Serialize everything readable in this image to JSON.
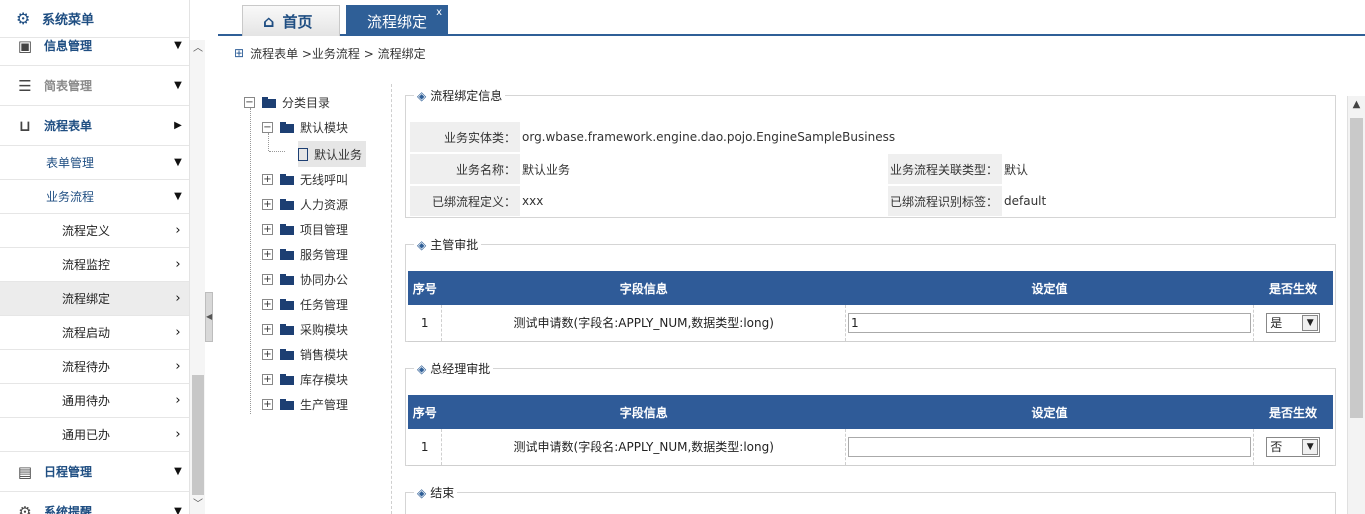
{
  "sidebar": {
    "title": "系统菜单",
    "items": [
      {
        "label": "信息管理",
        "level": 1,
        "icon": "calendar-icon",
        "arrow": "down"
      },
      {
        "label": "简表管理",
        "level": 1,
        "icon": "list-icon",
        "arrow": "down",
        "muted": true
      },
      {
        "label": "流程表单",
        "level": 1,
        "icon": "inbox-icon",
        "arrow": "right"
      },
      {
        "label": "表单管理",
        "level": 2,
        "arrow": "down"
      },
      {
        "label": "业务流程",
        "level": 2,
        "arrow": "down"
      },
      {
        "label": "流程定义",
        "level": 3,
        "arrow": "right"
      },
      {
        "label": "流程监控",
        "level": 3,
        "arrow": "right"
      },
      {
        "label": "流程绑定",
        "level": 3,
        "arrow": "right",
        "active": true
      },
      {
        "label": "流程启动",
        "level": 3,
        "arrow": "right"
      },
      {
        "label": "流程待办",
        "level": 3,
        "arrow": "right"
      },
      {
        "label": "通用待办",
        "level": 3,
        "arrow": "right"
      },
      {
        "label": "通用已办",
        "level": 3,
        "arrow": "right"
      },
      {
        "label": "日程管理",
        "level": 1,
        "icon": "calendar-icon",
        "arrow": "down"
      },
      {
        "label": "系统提醒",
        "level": 1,
        "icon": "gear-icon",
        "arrow": "down"
      }
    ]
  },
  "tabs": {
    "home": "首页",
    "current": "流程绑定",
    "close": "x"
  },
  "breadcrumb": "流程表单 >业务流程 > 流程绑定",
  "tree": {
    "root": "分类目录",
    "default_module": "默认模块",
    "default_business": "默认业务",
    "modules": [
      "无线呼叫",
      "人力资源",
      "项目管理",
      "服务管理",
      "协同办公",
      "任务管理",
      "采购模块",
      "销售模块",
      "库存模块",
      "生产管理"
    ]
  },
  "binding_info": {
    "legend": "流程绑定信息",
    "entity_label": "业务实体类：",
    "entity_value": "org.wbase.framework.engine.dao.pojo.EngineSampleBusiness",
    "name_label": "业务名称：",
    "name_value": "默认业务",
    "relation_label": "业务流程关联类型：",
    "relation_value": "默认",
    "flow_def_label": "已绑流程定义：",
    "flow_def_value": "xxx",
    "flow_tag_label": "已绑流程识别标签：",
    "flow_tag_value": "default"
  },
  "columns": {
    "seq": "序号",
    "field": "字段信息",
    "value": "设定值",
    "effective": "是否生效"
  },
  "sections": [
    {
      "legend": "主管审批",
      "seq": "1",
      "field": "测试申请数(字段名:APPLY_NUM,数据类型:long)",
      "value": "1",
      "effective": "是"
    },
    {
      "legend": "总经理审批",
      "seq": "1",
      "field": "测试申请数(字段名:APPLY_NUM,数据类型:long)",
      "value": "",
      "effective": "否"
    }
  ],
  "end_legend": "结束",
  "icons": {
    "sidebar_title": "gear-icon",
    "home_tab": "home-icon",
    "breadcrumb": "grid-icon",
    "legend": "layers-icon"
  },
  "colors": {
    "primary": "#2f5f97",
    "header": "#2f5b98",
    "menu_text": "#1f4e82"
  }
}
